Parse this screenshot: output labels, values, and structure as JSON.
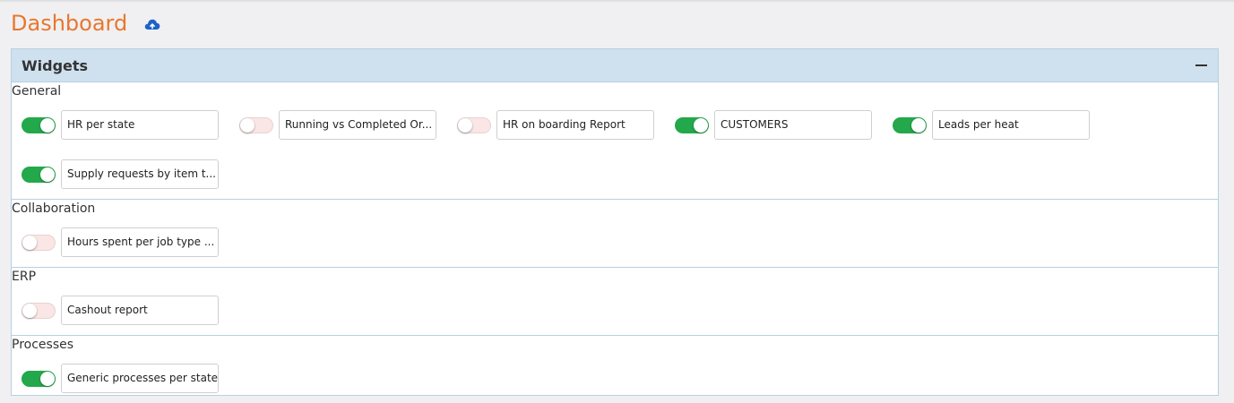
{
  "page": {
    "title": "Dashboard",
    "cloud_icon": "cloud-upload-icon"
  },
  "panel": {
    "title": "Widgets",
    "collapse_icon": "minus-icon"
  },
  "colors": {
    "title": "#e8772e",
    "toggle_on": "#23a84b",
    "toggle_off": "#fbe6e6",
    "panel_header": "#cfe1ef"
  },
  "sections": [
    {
      "title": "General",
      "widgets": [
        {
          "label": "HR per state",
          "enabled": true
        },
        {
          "label": "Running vs Completed Or...",
          "enabled": false
        },
        {
          "label": "HR on boarding Report",
          "enabled": false
        },
        {
          "label": "CUSTOMERS",
          "enabled": true
        },
        {
          "label": "Leads per heat",
          "enabled": true
        },
        {
          "label": "Supply requests by item t...",
          "enabled": true
        }
      ]
    },
    {
      "title": "Collaboration",
      "widgets": [
        {
          "label": "Hours spent per job type ...",
          "enabled": false
        }
      ]
    },
    {
      "title": "ERP",
      "widgets": [
        {
          "label": "Cashout report",
          "enabled": false
        }
      ]
    },
    {
      "title": "Processes",
      "widgets": [
        {
          "label": "Generic processes per state",
          "enabled": true
        }
      ]
    }
  ]
}
